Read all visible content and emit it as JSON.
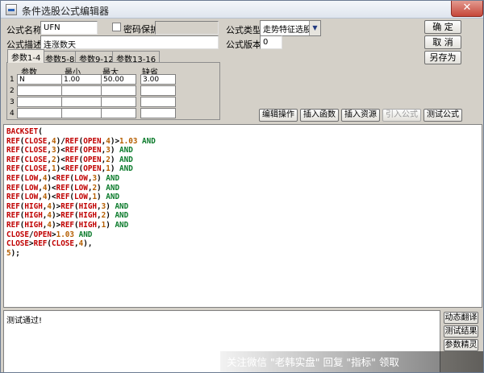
{
  "window": {
    "title": "条件选股公式编辑器",
    "close_label": "✕"
  },
  "form": {
    "name_label": "公式名称",
    "name_value": "UFN",
    "password_label": "密码保护",
    "desc_label": "公式描述",
    "desc_value": "连涨数天",
    "type_label": "公式类型",
    "type_value": "走势特征选股",
    "version_label": "公式版本",
    "version_value": "0"
  },
  "buttons": {
    "ok": "确  定",
    "cancel": "取  消",
    "save_as": "另存为"
  },
  "tabs": [
    "参数1-4",
    "参数5-8",
    "参数9-12",
    "参数13-16"
  ],
  "params": {
    "headers": [
      "参数",
      "最小",
      "最大",
      "缺省"
    ],
    "rows": [
      {
        "num": "1",
        "name": "N",
        "min": "1.00",
        "max": "50.00",
        "default": "3.00"
      },
      {
        "num": "2",
        "name": "",
        "min": "",
        "max": "",
        "default": ""
      },
      {
        "num": "3",
        "name": "",
        "min": "",
        "max": "",
        "default": ""
      },
      {
        "num": "4",
        "name": "",
        "min": "",
        "max": "",
        "default": ""
      }
    ]
  },
  "toolbar": {
    "edit": "编辑操作",
    "insert_func": "插入函数",
    "insert_res": "插入资源",
    "import": "引入公式",
    "test": "测试公式"
  },
  "code_lines": [
    "BACKSET(",
    "REF(CLOSE,4)/REF(OPEN,4)>1.03 AND",
    "REF(CLOSE,3)<REF(OPEN,3) AND",
    "REF(CLOSE,2)<REF(OPEN,2) AND",
    "REF(CLOSE,1)<REF(OPEN,1) AND",
    "REF(LOW,4)<REF(LOW,3) AND",
    "REF(LOW,4)<REF(LOW,2) AND",
    "REF(LOW,4)<REF(LOW,1) AND",
    "REF(HIGH,4)>REF(HIGH,3) AND",
    "REF(HIGH,4)>REF(HIGH,2) AND",
    "REF(HIGH,4)>REF(HIGH,1) AND",
    "CLOSE/OPEN>1.03 AND",
    "CLOSE>REF(CLOSE,4),",
    "5);"
  ],
  "output": {
    "text": "测试通过!"
  },
  "side": {
    "translate": "动态翻译",
    "result": "测试结果",
    "param": "参数精灵"
  },
  "watermark": {
    "text": "关注微信 \"老韩实盘\" 回复 \"指标\" 领取"
  }
}
